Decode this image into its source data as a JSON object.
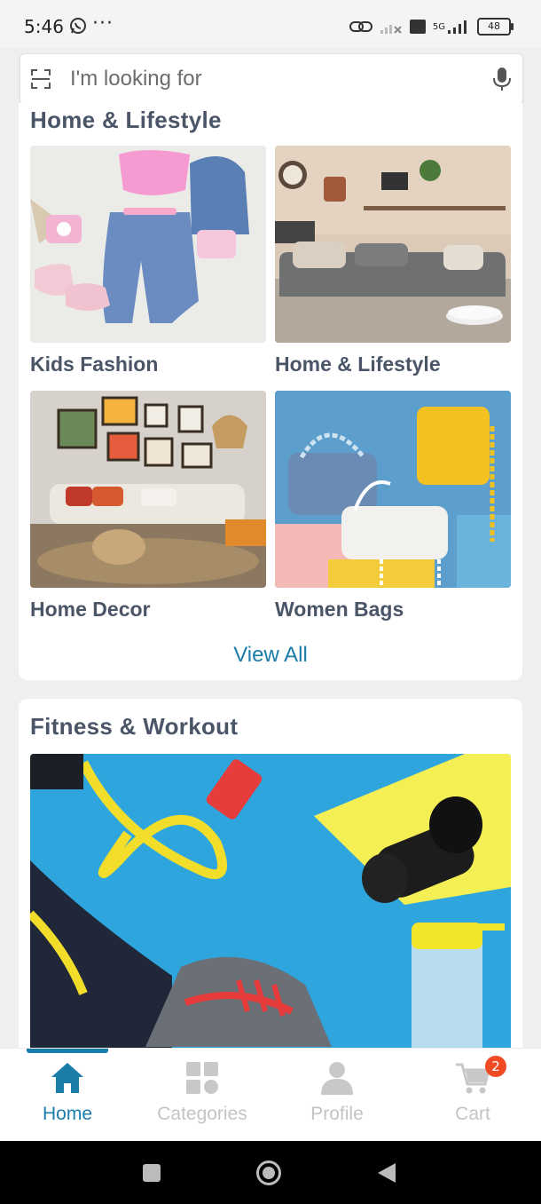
{
  "status_bar": {
    "time": "5:46",
    "dots": "···",
    "network": "5G",
    "battery": "48"
  },
  "search": {
    "placeholder": "I'm looking for"
  },
  "section_home": {
    "title": "Home & Lifestyle",
    "tiles": [
      {
        "label": "Kids Fashion"
      },
      {
        "label": "Home & Lifestyle"
      },
      {
        "label": "Home Decor"
      },
      {
        "label": "Women Bags"
      }
    ],
    "view_all": "View All"
  },
  "section_fitness": {
    "title": "Fitness & Workout"
  },
  "bottom_nav": {
    "items": [
      {
        "label": "Home",
        "icon": "home-icon",
        "active": true
      },
      {
        "label": "Categories",
        "icon": "categories-icon",
        "active": false
      },
      {
        "label": "Profile",
        "icon": "profile-icon",
        "active": false
      },
      {
        "label": "Cart",
        "icon": "cart-icon",
        "active": false
      }
    ],
    "cart_count": "2"
  },
  "colors": {
    "accent": "#1a7ca8",
    "inactive": "#c4c4c4",
    "badge": "#ef4a23",
    "title": "#4a5568"
  }
}
